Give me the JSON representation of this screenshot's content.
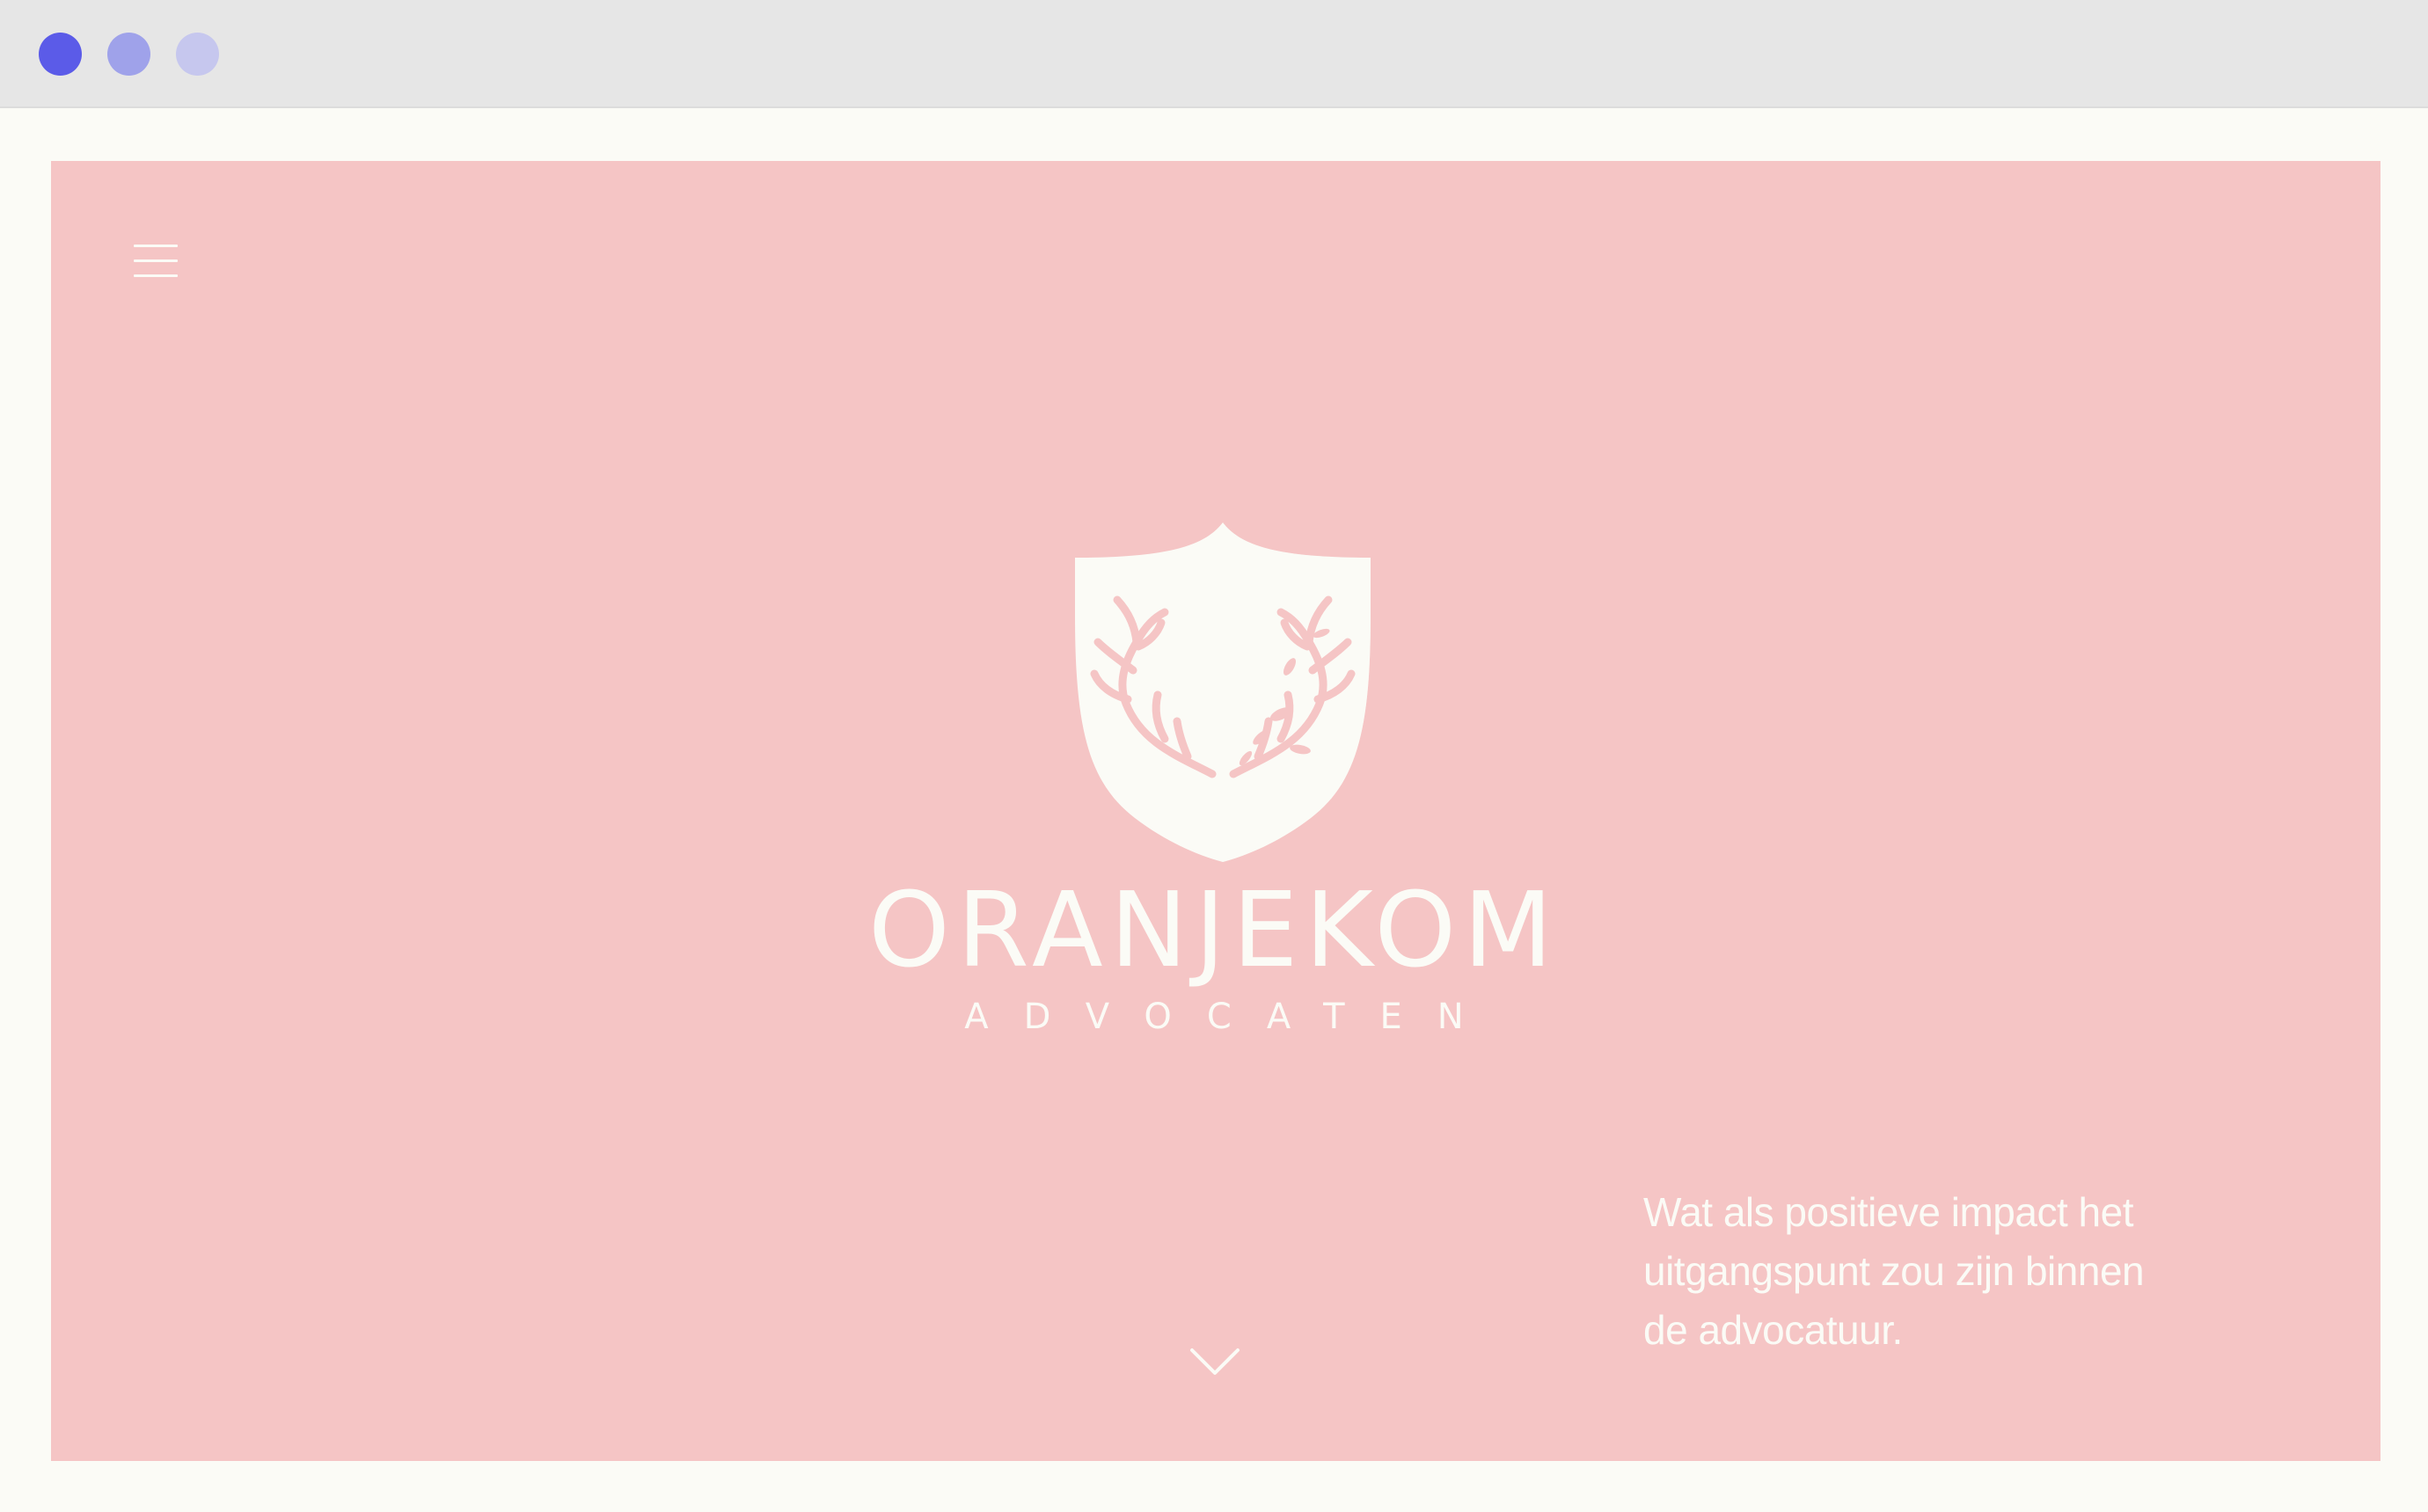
{
  "colors": {
    "titlebar": "#e6e6e6",
    "page_bg": "#fbfbf6",
    "hero_bg": "#f5c5c5",
    "foreground": "#fbfbf6",
    "traffic_light_1": "#5b5be8",
    "traffic_light_2": "#9fa2ea",
    "traffic_light_3": "#c6c7ee"
  },
  "icons": {
    "menu": "hamburger-icon",
    "logo": "shield-antlers-icon",
    "scroll": "chevron-down-icon"
  },
  "hero": {
    "logo_word": "ORANJEKOM",
    "logo_sub": "ADVOCATEN",
    "tagline_lines": [
      "Wat als positieve impact het",
      "uitgangspunt zou zijn binnen",
      "de advocatuur."
    ]
  }
}
